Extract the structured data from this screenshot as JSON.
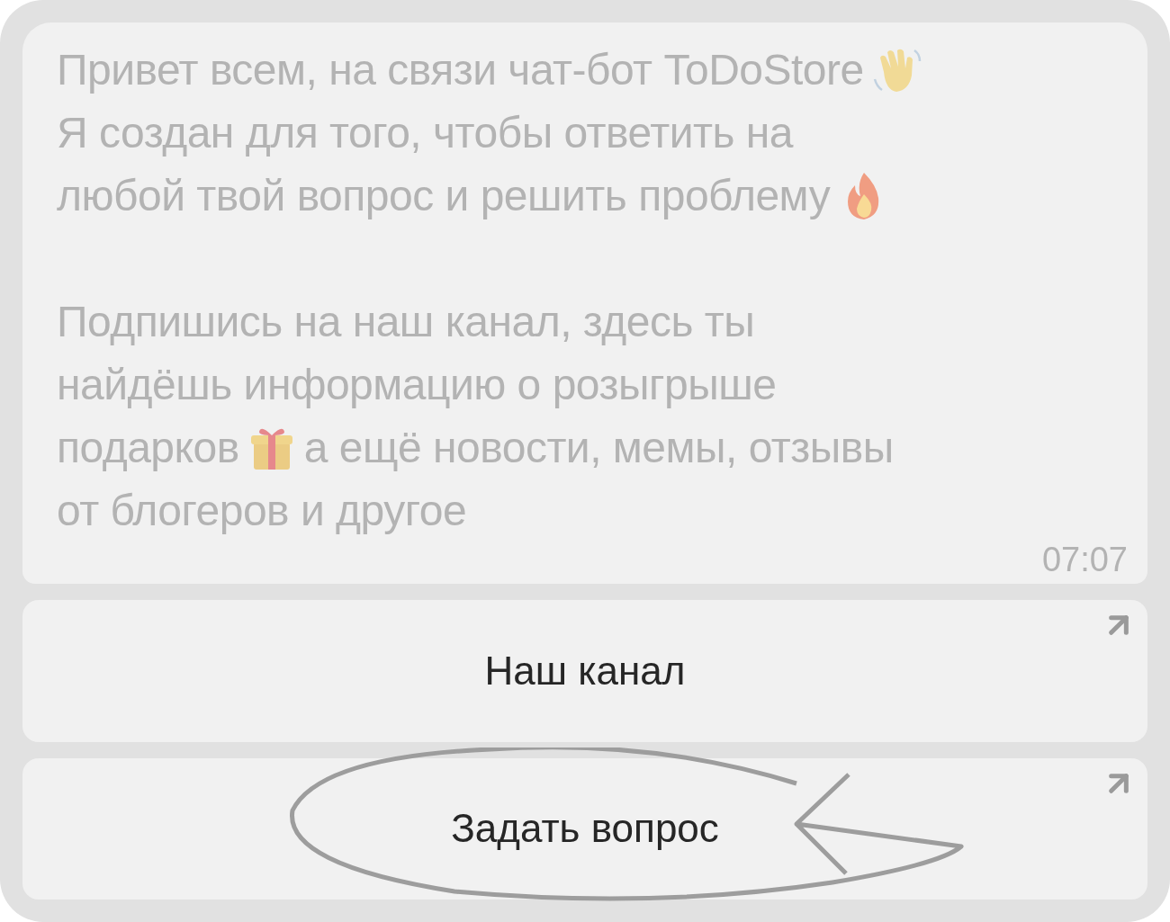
{
  "message": {
    "paragraphs": [
      [
        [
          {
            "kind": "text",
            "text": "Привет всем, на связи чат-бот ToDoStore"
          },
          {
            "kind": "wave"
          }
        ],
        [
          {
            "kind": "text",
            "text": "Я создан для того, чтобы ответить на"
          }
        ],
        [
          {
            "kind": "text",
            "text": "любой твой вопрос и решить проблему"
          },
          {
            "kind": "fire"
          }
        ]
      ],
      [
        [
          {
            "kind": "text",
            "text": "Подпишись на наш канал, здесь ты"
          }
        ],
        [
          {
            "kind": "text",
            "text": "найдёшь информацию о розыгрыше"
          }
        ],
        [
          {
            "kind": "text",
            "text": "подарков"
          },
          {
            "kind": "gift"
          },
          {
            "kind": "text",
            "text": "а ещё новости, мемы, отзывы"
          }
        ],
        [
          {
            "kind": "text",
            "text": "от блогеров и другое"
          }
        ]
      ]
    ],
    "time": "07:07"
  },
  "buttons": [
    {
      "label": "Наш канал",
      "highlighted": false
    },
    {
      "label": "Задать вопрос",
      "highlighted": true
    }
  ]
}
